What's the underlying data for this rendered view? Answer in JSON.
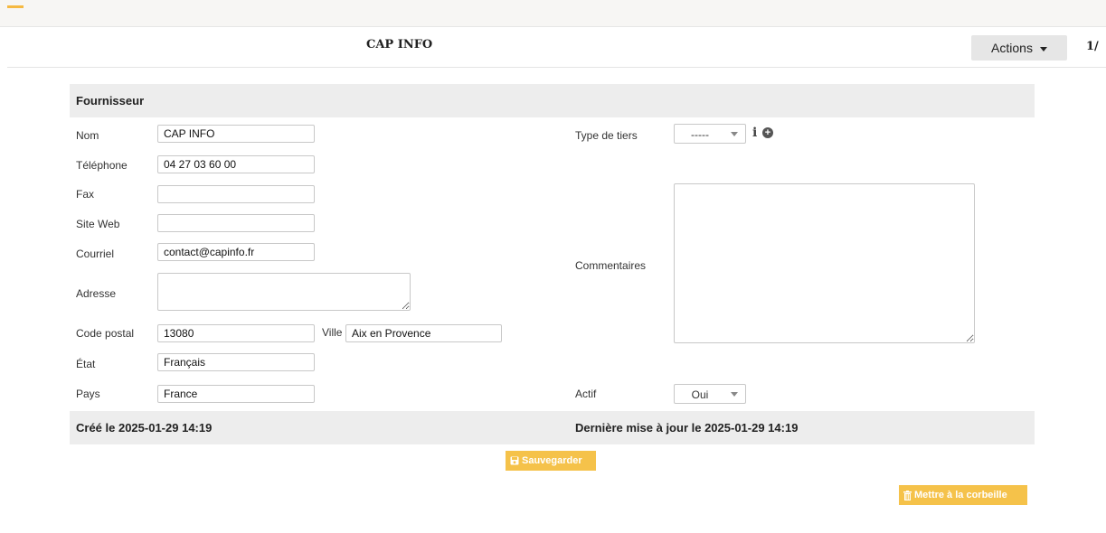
{
  "header": {
    "title": "CAP INFO",
    "actions_label": "Actions",
    "pager": "1/"
  },
  "section": {
    "title": "Fournisseur"
  },
  "fields": {
    "nom": {
      "label": "Nom",
      "value": "CAP INFO"
    },
    "telephone": {
      "label": "Téléphone",
      "value": "04 27 03 60 00"
    },
    "fax": {
      "label": "Fax",
      "value": ""
    },
    "site_web": {
      "label": "Site Web",
      "value": ""
    },
    "courriel": {
      "label": "Courriel",
      "value": "contact@capinfo.fr"
    },
    "adresse": {
      "label": "Adresse",
      "value": ""
    },
    "code_postal": {
      "label": "Code postal",
      "value": "13080"
    },
    "ville": {
      "label": "Ville",
      "value": "Aix en Provence"
    },
    "etat": {
      "label": "État",
      "value": "Français"
    },
    "pays": {
      "label": "Pays",
      "value": "France"
    },
    "type_tiers": {
      "label": "Type de tiers",
      "value": "-----"
    },
    "commentaires": {
      "label": "Commentaires",
      "value": ""
    },
    "actif": {
      "label": "Actif",
      "value": "Oui"
    }
  },
  "footer": {
    "created": "Créé le 2025-01-29 14:19",
    "updated": "Dernière mise à jour le 2025-01-29 14:19"
  },
  "buttons": {
    "save": "Sauvegarder",
    "trash": "Mettre à la corbeille"
  },
  "icons": {
    "info": "i",
    "add": "+"
  },
  "colors": {
    "accent": "#f5c24a",
    "section_bg": "#ededed"
  }
}
